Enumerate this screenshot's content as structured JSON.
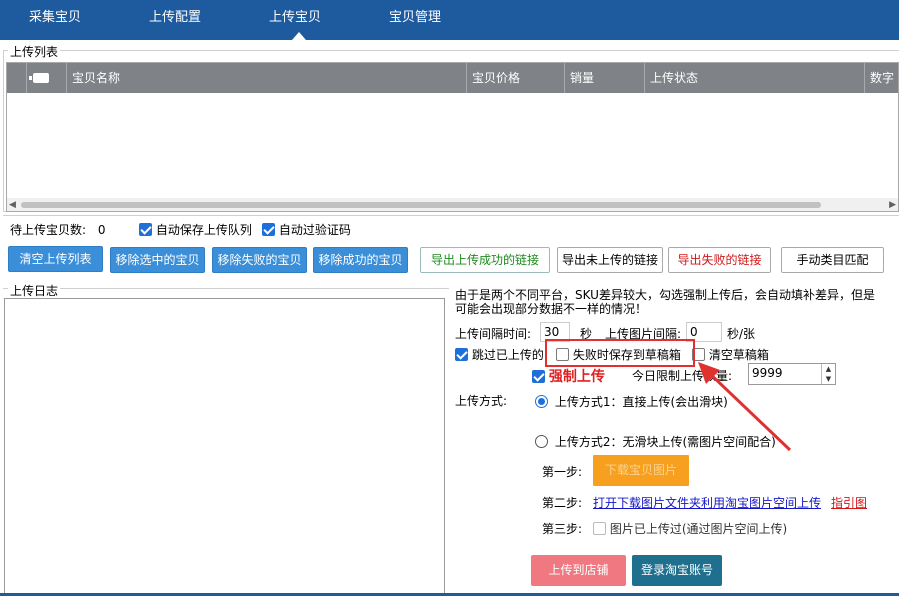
{
  "nav": {
    "tabs": [
      {
        "label": "采集宝贝"
      },
      {
        "label": "上传配置"
      },
      {
        "label": "上传宝贝",
        "active": true
      },
      {
        "label": "宝贝管理"
      }
    ]
  },
  "upload_list": {
    "title": "上传列表",
    "columns": [
      "宝贝名称",
      "宝贝价格",
      "销量",
      "上传状态",
      "数字"
    ]
  },
  "queue": {
    "pending_label": "待上传宝贝数:",
    "pending_count": "0",
    "auto_save_label": "自动保存上传队列",
    "auto_save_checked": true,
    "auto_captcha_label": "自动过验证码",
    "auto_captcha_checked": true
  },
  "actions": {
    "clear": "清空上传列表",
    "remove_selected": "移除选中的宝贝",
    "remove_failed": "移除失败的宝贝",
    "remove_success": "移除成功的宝贝",
    "export_success": "导出上传成功的链接",
    "export_not_uploaded": "导出未上传的链接",
    "export_failed": "导出失败的链接",
    "manual_category": "手动类目匹配"
  },
  "log": {
    "title": "上传日志"
  },
  "settings": {
    "notice": "由于是两个不同平台，SKU差异较大，勾选强制上传后，会自动填补差异，但是可能会出现部分数据不一样的情况！",
    "interval_label": "上传间隔时间:",
    "interval_value": "30",
    "interval_unit": "秒",
    "image_interval_label": "上传图片间隔:",
    "image_interval_value": "0",
    "image_interval_unit": "秒/张",
    "skip_uploaded_label": "跳过已上传的",
    "save_draft_label": "失败时保存到草稿箱",
    "clear_draft_label": "清空草稿箱",
    "force_upload_label": "强制上传",
    "daily_limit_label": "今日限制上传数量:",
    "daily_limit_value": "9999",
    "method_label": "上传方式:",
    "method1_label": "上传方式1：直接上传(会出滑块)",
    "method2_label": "上传方式2：无滑块上传(需图片空间配合)",
    "step1_label": "第一步:",
    "step1_button": "下载宝贝图片",
    "step2_label": "第二步:",
    "step2_link": "打开下载图片文件夹利用淘宝图片空间上传",
    "step2_guide": "指引图",
    "step3_label": "第三步:",
    "step3_checkbox": "图片已上传过(通过图片空间上传)",
    "upload_store_button": "上传到店铺",
    "login_button": "登录淘宝账号"
  },
  "colors": {
    "nav": "#1e5a9e",
    "accent_blue": "#3b8fd9",
    "orange": "#f7a020",
    "pink": "#f07880",
    "teal": "#1f6f8e",
    "red": "#e03030"
  }
}
